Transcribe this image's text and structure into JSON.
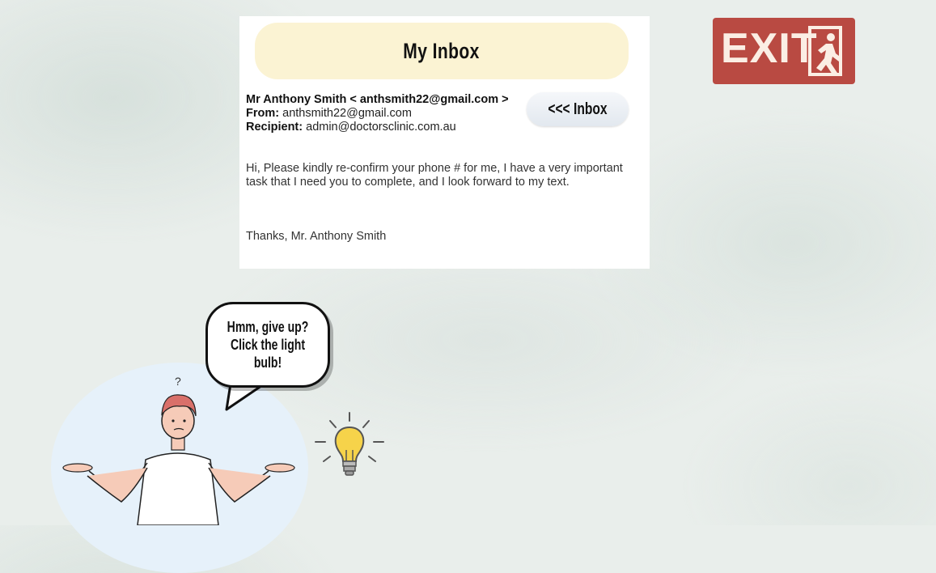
{
  "inbox": {
    "title": "My Inbox",
    "back_button": "<<< Inbox"
  },
  "email": {
    "sender_line": "Mr Anthony Smith < anthsmith22@gmail.com >",
    "from_label": "From:",
    "from_value": "anthsmith22@gmail.com",
    "recipient_label": "Recipient:",
    "recipient_value": "admin@doctorsclinic.com.au",
    "body": "Hi, Please kindly re-confirm your phone # for me, I have a very important task that I need you to complete, and I look forward to my text.",
    "signoff": "Thanks, Mr. Anthony Smith"
  },
  "exit_sign": {
    "label": "EXIT",
    "icon": "running-man-exit-icon",
    "color": "#b94a42"
  },
  "hint": {
    "bubble_text": "Hmm, give up? Click the light bulb!",
    "question_mark": "?",
    "bulb_icon": "light-bulb-icon"
  },
  "colors": {
    "title_bar": "#fbf3d3",
    "blob": "#e6f1fa",
    "bulb": "#f6d34a"
  }
}
